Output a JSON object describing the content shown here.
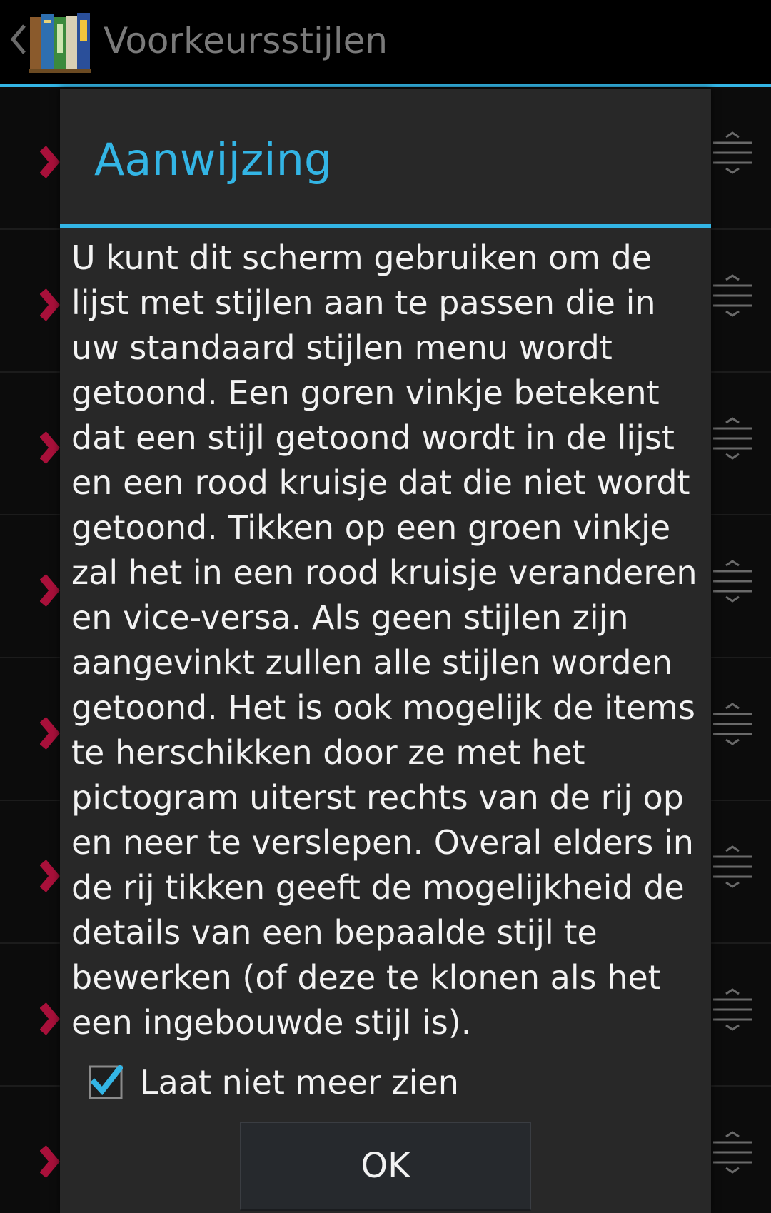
{
  "action_bar": {
    "title": "Voorkeursstijlen",
    "back_icon": "chevron-left-icon",
    "app_icon": "books-icon"
  },
  "background_list": {
    "row_icon_left": "red-cross-icon",
    "row_icon_right": "drag-handle-icon"
  },
  "dialog": {
    "title": "Aanwijzing",
    "message": "U kunt dit scherm gebruiken om de lijst met stijlen aan te passen die in uw standaard stijlen menu wordt getoond. Een goren vinkje betekent dat een stijl getoond wordt in de lijst en een rood kruisje dat die niet wordt getoond. Tikken op een groen vinkje zal het in een rood kruisje veranderen en vice-versa. Als geen stijlen zijn aangevinkt zullen alle stijlen worden getoond. Het is ook mogelijk de items te herschikken door ze met het pictogram uiterst rechts van de rij op en neer te verslepen. Overal elders in de rij tikken geeft de mogelijkheid de details van een bepaalde stijl te bewerken (of deze te klonen als het een ingebouwde stijl is).",
    "checkbox": {
      "label": "Laat niet meer zien",
      "checked": true
    },
    "ok_label": "OK"
  },
  "colors": {
    "accent": "#33b5e5",
    "dialog_bg": "#282828",
    "text": "#f2f2f2",
    "title_gray": "#7a7a7a",
    "cross_red": "#b0103a"
  }
}
